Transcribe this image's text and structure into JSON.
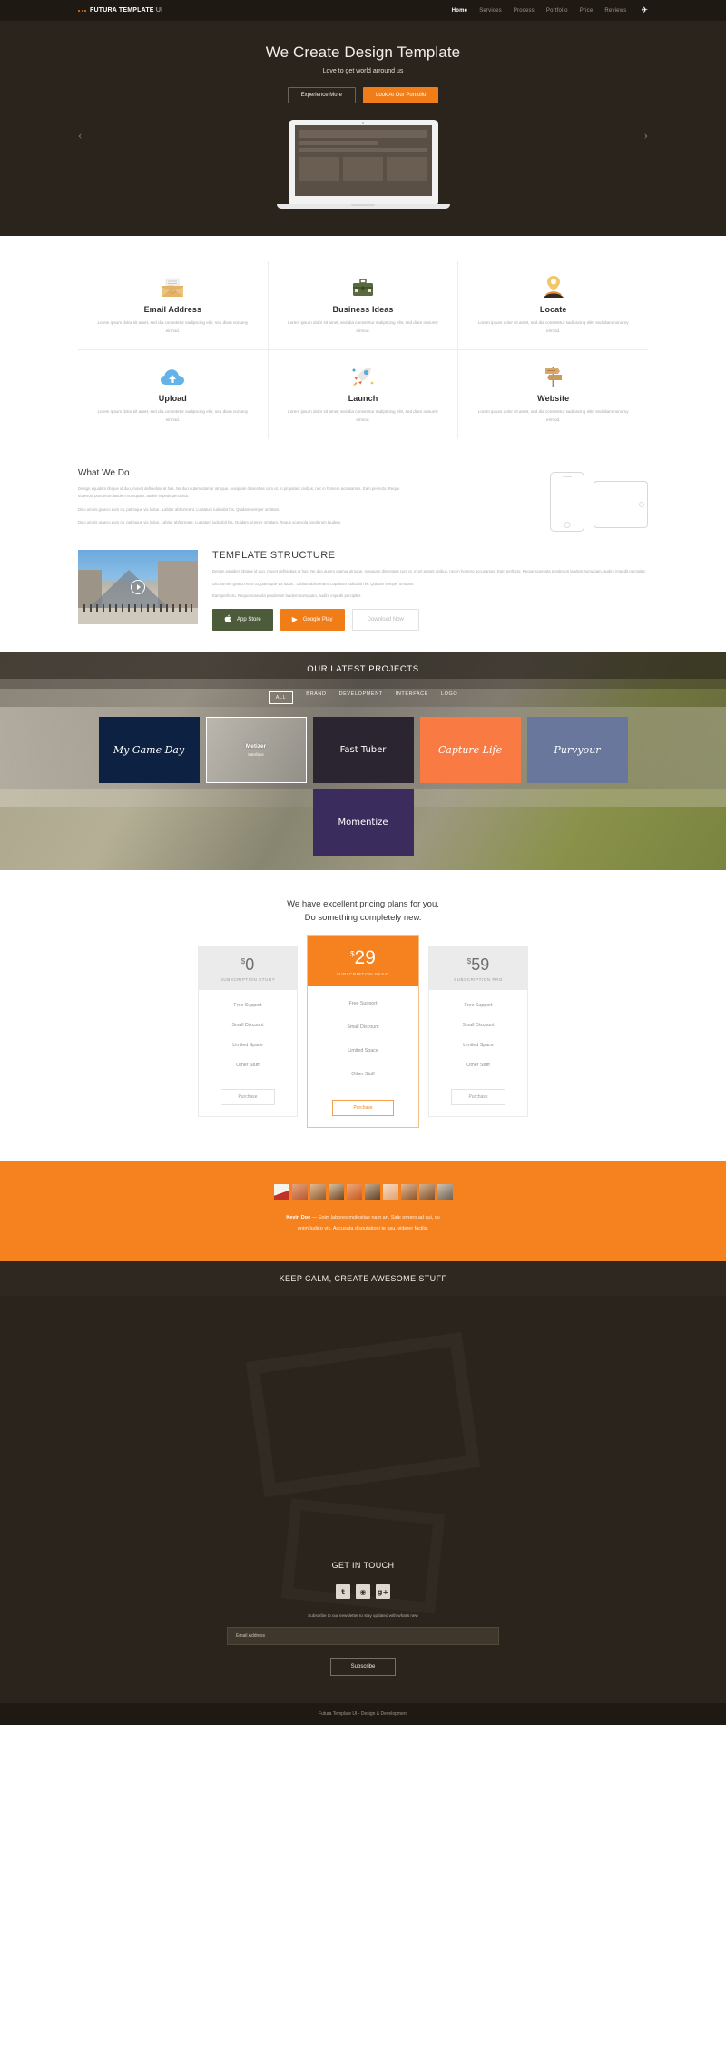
{
  "nav": {
    "brand": "FUTURA TEMPLATE",
    "brand_suffix": "UI",
    "links": [
      {
        "label": "Home",
        "active": true
      },
      {
        "label": "Services",
        "active": false
      },
      {
        "label": "Process",
        "active": false
      },
      {
        "label": "Portfolio",
        "active": false
      },
      {
        "label": "Price",
        "active": false
      },
      {
        "label": "Reviews",
        "active": false
      }
    ],
    "plane_icon": "✈"
  },
  "hero": {
    "title": "We Create Design Template",
    "subtitle": "Love to get world arround us",
    "btn_secondary": "Experience More",
    "btn_primary": "Look At Our Portfolio",
    "arrow_left": "‹",
    "arrow_right": "›"
  },
  "services": [
    {
      "icon": "envelope-icon",
      "title": "Email Address",
      "text": "Lorem ipsum dolor sit amet, sed dia consetetur sadipscing elitr, sed diam nonumy eirmod."
    },
    {
      "icon": "briefcase-icon",
      "title": "Business Ideas",
      "text": "Lorem ipsum dolor sit amet, sed dia consetetur sadipscing elitr, sed diam nonumy eirmod."
    },
    {
      "icon": "location-pin-icon",
      "title": "Locate",
      "text": "Lorem ipsum dolor sit amet, sed dia consetetur sadipscing elitr, sed diam nonumy eirmod."
    },
    {
      "icon": "cloud-upload-icon",
      "title": "Upload",
      "text": "Lorem ipsum dolor sit amet, sed dia consetetur sadipscing elitr, sed diam nonumy eirmod."
    },
    {
      "icon": "rocket-launch-icon",
      "title": "Launch",
      "text": "Lorem ipsum dolor sit amet, sed dia consetetur sadipscing elitr, sed diam nonumy eirmod."
    },
    {
      "icon": "signpost-icon",
      "title": "Website",
      "text": "Lorem ipsum dolor sit amet, sed dia consetetur sadipscing elitr, sed diam nonumy eirmod."
    }
  ],
  "whatwedo": {
    "title": "What We Do",
    "p1": "Design equidem tibique id duo, movet definiebas at has. Ne duo autem utamur utroque, nusquam dissentias cum ut, in pri putant civibus, nec in homero accusamus. Eam perfecto. Reque scaevola ponderum laudem numquam, audire impedit percipitur.",
    "p2": "Dico omnis graeco eum cu, patrioque vix ludus . Labitur abhorreant. Luptatum iudicabit his. Quidam semper omittam.",
    "p3": "Dico omnis graeco eum cu, patrioque vix ludus. Labitur abhorreant. Luptatum iudicabit his. Quidam semper omittam. Reque scaevola ponderum laudem."
  },
  "template_structure": {
    "title": "TEMPLATE STRUCTURE",
    "p1": "Design equidem tibique id duo, movet definiebas at has. Ne duo autem utamur utroque, nusquam dissentias cum ut, in pri putant civibus, nec in homero accusamus. Eam perfecto. Reque scaevola ponderum laudem numquam, audire impedit percipitur.",
    "p2": "Dico omnis graeco eum cu, patrioque vix ludus . Labitur abhorreant. Luptatum iudicabit his. Quidam semper omittam.",
    "p3": "Eam perfecto. Reque scaevola ponderum laudem numquam, audire impedit percipitur.",
    "btn_apple": "App Store",
    "btn_google": "Google Play",
    "btn_download": "Download Now",
    "apple_glyph": "",
    "play_glyph": "▶",
    "play_button_icon": "play-icon"
  },
  "projects": {
    "heading": "OUR LATEST PROJECTS",
    "filters": [
      {
        "label": "ALL",
        "active": true
      },
      {
        "label": "BRAND",
        "active": false
      },
      {
        "label": "DEVELOPMENT",
        "active": false
      },
      {
        "label": "INTERFACE",
        "active": false
      },
      {
        "label": "LOGO",
        "active": false
      }
    ],
    "cards": [
      {
        "title": "My Game Day",
        "subtitle": "",
        "style": "c1"
      },
      {
        "title": "Metizer",
        "subtitle": "Interface",
        "style": "c2"
      },
      {
        "title": "Fast Tuber",
        "subtitle": "",
        "style": "c3"
      },
      {
        "title": "Capture Life",
        "subtitle": "",
        "style": "c4"
      },
      {
        "title": "Purvyour",
        "subtitle": "",
        "style": "c5"
      },
      {
        "title": "Momentize",
        "subtitle": "",
        "style": "c6"
      }
    ]
  },
  "pricing": {
    "line1": "We have excellent pricing plans for you.",
    "line2": "Do something completely new.",
    "plans": [
      {
        "currency": "$",
        "price": "0",
        "name": "SUBSCRIPTION STUDY",
        "features": [
          "Free Support",
          "Small Discount",
          "Limited Space",
          "Other Stuff"
        ],
        "button": "Purchase",
        "featured": false
      },
      {
        "currency": "$",
        "price": "29",
        "name": "SUBSCRIPTION BASIC",
        "features": [
          "Free Support",
          "Small Discount",
          "Limited Space",
          "Other Stuff"
        ],
        "button": "Purchase",
        "featured": true
      },
      {
        "currency": "$",
        "price": "59",
        "name": "SUBSCRIPTION PRO",
        "features": [
          "Free Support",
          "Small Discount",
          "Limited Space",
          "Other Stuff"
        ],
        "button": "Purchase",
        "featured": false
      }
    ]
  },
  "testimonial": {
    "author": "Kevin Doe",
    "dash": "—",
    "quote_line1": "Enim labores molestiae nam an. Sale ornero ad qui, cu",
    "quote_line2": "enim ludico vix. Accusata disputationi te usu, viderer facilis."
  },
  "keepcalm": "KEEP CALM, CREATE AWESOME STUFF",
  "footer": {
    "title": "GET IN TOUCH",
    "socials": [
      {
        "name": "twitter-icon",
        "glyph": "t"
      },
      {
        "name": "dribbble-icon",
        "glyph": "◉"
      },
      {
        "name": "google-plus-icon",
        "glyph": "g+"
      }
    ],
    "note": "Subscribe to our newsletter to stay updated with what's new",
    "email_placeholder": "Email Address",
    "subscribe": "Subscribe",
    "copyright": "Futura Template UI - Design & Development"
  },
  "colors": {
    "accent": "#f5811f",
    "dark": "#2b241c",
    "darker": "#1e1913"
  }
}
